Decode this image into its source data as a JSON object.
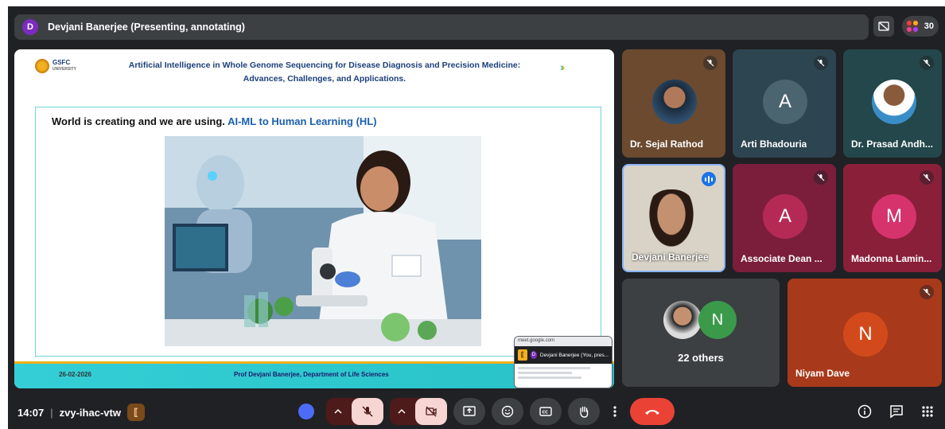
{
  "presenter_bar": {
    "avatar_letter": "D",
    "title": "Devjani Banerjee (Presenting, annotating)",
    "participant_count": "30"
  },
  "slide": {
    "logo_text": "GSFC",
    "logo_sub": "UNIVERSITY",
    "title_line1": "Artificial Intelligence in Whole Genome Sequencing for Disease Diagnosis and Precision Medicine:",
    "title_line2": "Advances, Challenges, and Applications.",
    "headline_prefix": "World is creating and we are using.",
    "headline_highlight": "AI-ML to Human Learning (HL)",
    "footer_date": "26-02-2026",
    "footer_presenter": "Prof Devjani Banerjee, Department of Life Sciences"
  },
  "mini_preview": {
    "url": "meet.google.com",
    "avatar_letter": "D",
    "label": "Devjani Banerjee (You, pres..."
  },
  "participants": [
    {
      "name": "Dr. Sejal Rathod",
      "type": "photo",
      "muted": true
    },
    {
      "name": "Arti Bhadouria",
      "type": "letter",
      "letter": "A",
      "muted": true
    },
    {
      "name": "Dr. Prasad Andh...",
      "type": "photo",
      "muted": true
    },
    {
      "name": "Devjani Banerjee",
      "type": "video",
      "speaking": true
    },
    {
      "name": "Associate Dean ...",
      "type": "letter",
      "letter": "A",
      "muted": true
    },
    {
      "name": "Madonna Lamin...",
      "type": "letter",
      "letter": "M",
      "muted": true
    },
    {
      "name": "22 others",
      "type": "group",
      "letter": "N"
    },
    {
      "name": "Niyam Dave",
      "type": "letter",
      "letter": "N",
      "muted": true
    }
  ],
  "bottom_bar": {
    "time": "14:07",
    "meeting_code": "zvy-ihac-vtw"
  },
  "colors": {
    "background": "#202124",
    "tile_bg": "#3c4043",
    "accent_cyan": "#34cfd6",
    "end_call": "#ea4335",
    "mic_off_bg": "#4d1b19"
  }
}
